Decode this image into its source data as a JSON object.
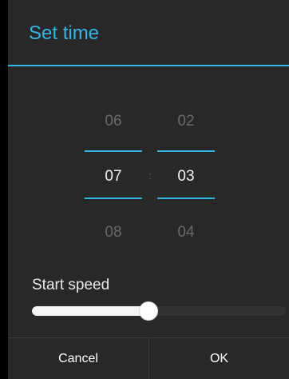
{
  "dialog": {
    "title": "Set time"
  },
  "time_picker": {
    "hour": {
      "prev": "06",
      "current": "07",
      "next": "08"
    },
    "minute": {
      "prev": "02",
      "current": "03",
      "next": "04"
    },
    "separator": ":"
  },
  "speed": {
    "label": "Start speed",
    "value_fraction": 0.46
  },
  "buttons": {
    "cancel": "Cancel",
    "ok": "OK"
  },
  "colors": {
    "accent": "#33b5e5",
    "dialog_background": "#282828"
  }
}
